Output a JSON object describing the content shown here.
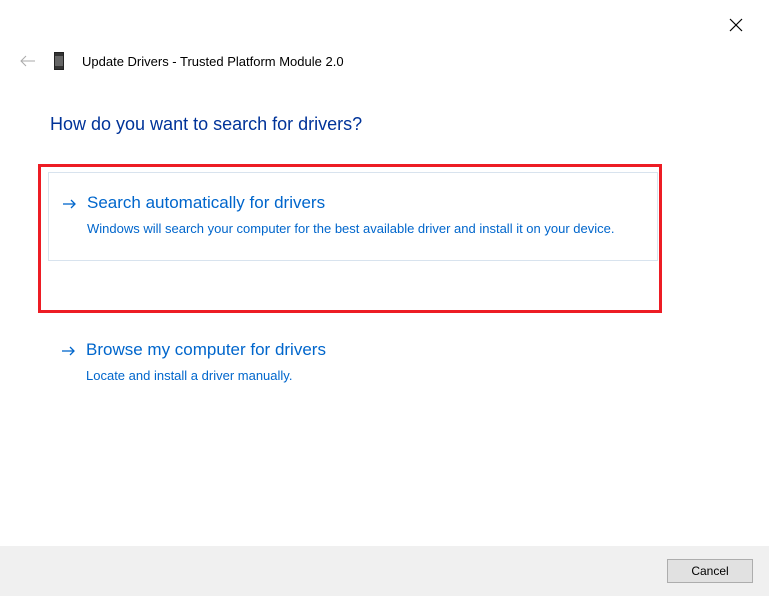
{
  "header": {
    "title": "Update Drivers - Trusted Platform Module 2.0"
  },
  "main": {
    "question": "How do you want to search for drivers?"
  },
  "options": [
    {
      "title": "Search automatically for drivers",
      "description": "Windows will search your computer for the best available driver and install it on your device."
    },
    {
      "title": "Browse my computer for drivers",
      "description": "Locate and install a driver manually."
    }
  ],
  "footer": {
    "cancel_label": "Cancel"
  }
}
